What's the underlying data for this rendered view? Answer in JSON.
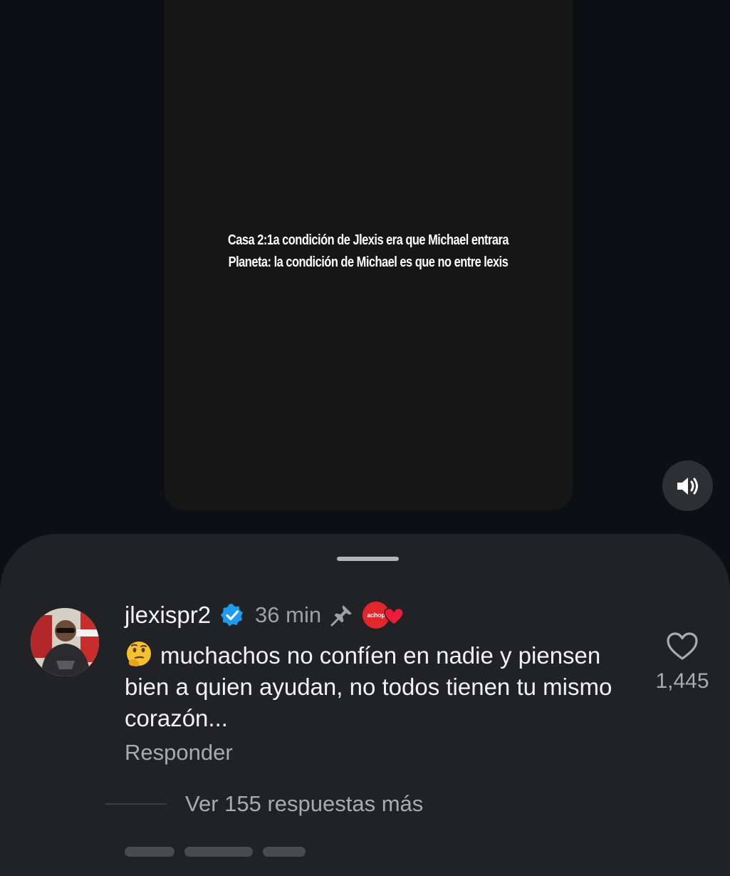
{
  "reel": {
    "caption_line1": "Casa 2:1a condición de Jlexis era que Michael entrara",
    "caption_line2": "Planeta: la condición de Michael es que no entre lexis"
  },
  "comment": {
    "username": "jlexispr2",
    "timestamp": "36 min",
    "badge_label": "achop",
    "text": "muchachos no confíen en nadie y piensen bien a quien ayudan, no todos tienen tu mismo corazón...",
    "emoji": "thinking-face",
    "reply_label": "Responder",
    "like_count": "1,445",
    "view_replies_label": "Ver 155 respuestas más"
  },
  "icons": {
    "volume": "volume-icon",
    "verified": "verified-badge-icon",
    "pin": "pin-icon",
    "heart": "heart-icon"
  },
  "colors": {
    "verified_blue": "#1d9bf0",
    "badge_red": "#e3262b",
    "sheet_bg": "#212226",
    "page_bg": "#0c1015"
  }
}
